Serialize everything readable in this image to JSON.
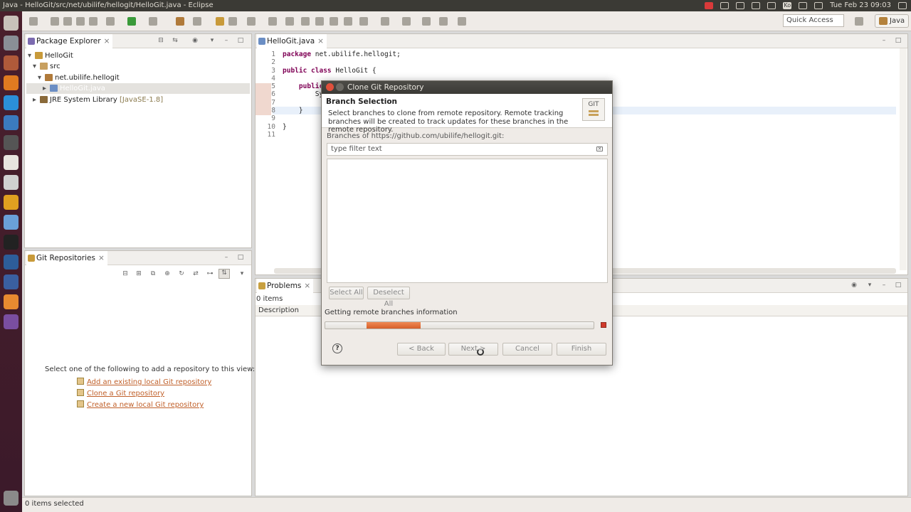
{
  "window": {
    "title": "Java - HelloGit/src/net/ubilife/hellogit/HelloGit.java - Eclipse"
  },
  "system": {
    "clock": "Tue Feb 23 09:03",
    "keyboard": "Ko"
  },
  "toolbar": {
    "quick_access": "Quick Access",
    "perspective": "Java"
  },
  "package_explorer": {
    "tab": "Package Explorer",
    "tree": [
      {
        "label": "HelloGit",
        "arrow": "▾",
        "level": 0
      },
      {
        "label": "src",
        "arrow": "▾",
        "level": 1
      },
      {
        "label": "net.ubilife.hellogit",
        "arrow": "▾",
        "level": 2
      },
      {
        "label": "HelloGit.java",
        "arrow": "▸",
        "level": 3,
        "selected": true
      },
      {
        "label": "JRE System Library",
        "suffix": "[JavaSE-1.8]",
        "arrow": "▸",
        "level": 1
      }
    ]
  },
  "git_repositories": {
    "tab": "Git Repositories",
    "prompt": "Select one of the following to add a repository to this view:",
    "links": [
      "Add an existing local Git repository",
      "Clone a Git repository",
      "Create a new local Git repository"
    ]
  },
  "editor": {
    "tab": "HelloGit.java",
    "lines": [
      {
        "n": "1",
        "kw": "package",
        "text": " net.ubilife.hellogit;"
      },
      {
        "n": "2",
        "kw": "",
        "text": ""
      },
      {
        "n": "3",
        "kw": "public class",
        "text": " HelloGit {"
      },
      {
        "n": "4",
        "kw": "",
        "text": ""
      },
      {
        "n": "5",
        "kw": "    public s",
        "text": ""
      },
      {
        "n": "6",
        "kw": "",
        "text": "        Syste"
      },
      {
        "n": "7",
        "kw": "",
        "text": ""
      },
      {
        "n": "8",
        "kw": "",
        "text": "    }"
      },
      {
        "n": "9",
        "kw": "",
        "text": ""
      },
      {
        "n": "10",
        "kw": "",
        "text": "}"
      },
      {
        "n": "11",
        "kw": "",
        "text": ""
      }
    ]
  },
  "problems": {
    "tab": "Problems",
    "count": "0 items",
    "column": "Description"
  },
  "dialog": {
    "title": "Clone Git Repository",
    "heading": "Branch Selection",
    "description": "Select branches to clone from remote repository. Remote tracking branches will be created to track updates for these branches in the remote repository.",
    "logo": "GIT",
    "branches_label": "Branches of https://github.com/ubilife/hellogit.git:",
    "filter_placeholder": "type filter text",
    "select_all": "Select All",
    "deselect_all": "Deselect All",
    "status": "Getting remote branches information",
    "progress_start": 0.155,
    "progress_end": 0.355,
    "back": "< Back",
    "next": "Next >",
    "cancel": "Cancel",
    "finish": "Finish"
  },
  "statusbar": {
    "text": "0 items selected"
  },
  "colors": {
    "accent": "#d65f2a",
    "link": "#c0602a",
    "launcher": "#4a1f2c"
  }
}
